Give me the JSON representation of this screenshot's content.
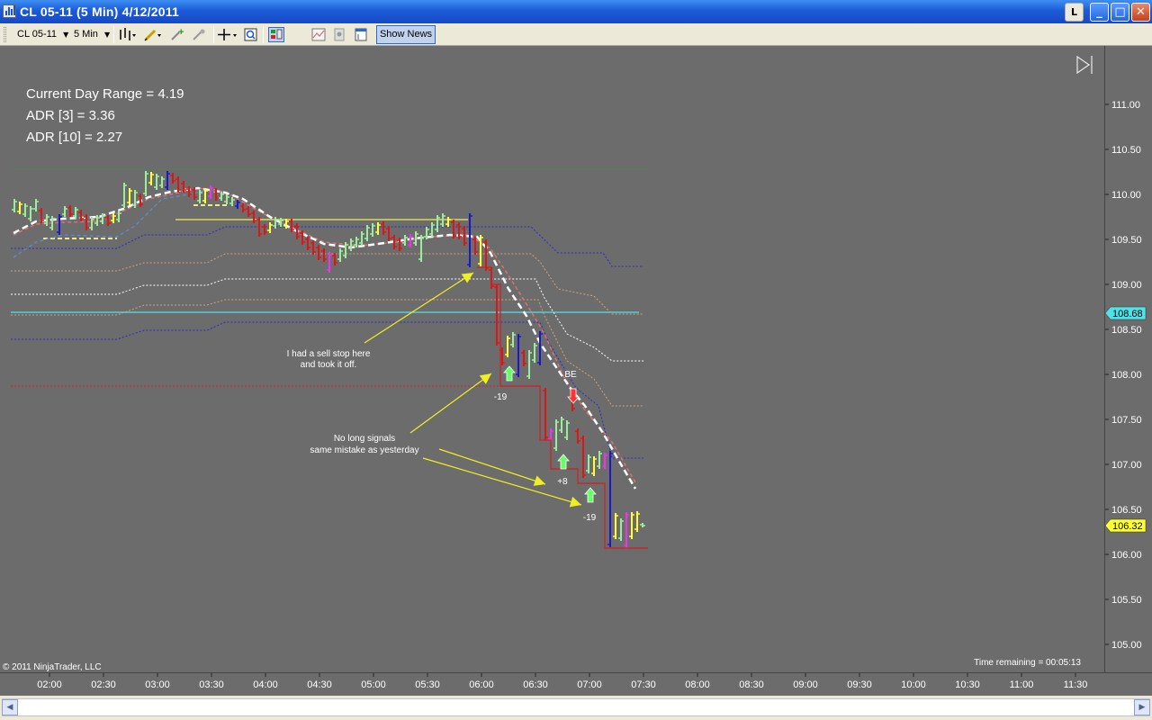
{
  "window": {
    "title": "CL 05-11 (5 Min)  4/12/2011",
    "buttons": {
      "light": "L",
      "minimize": "_",
      "maximize": "□",
      "close": "✕"
    }
  },
  "toolbar": {
    "instrument": "CL 05-11",
    "interval": "5 Min",
    "show_news": "Show News",
    "icons": [
      "bars-style-icon",
      "pencil-draw-icon",
      "add-indicator-icon",
      "strategy-icon",
      "crosshair-icon",
      "zoom-icon",
      "chart-trader-icon",
      "data-box-icon",
      "properties-icon",
      "print-icon",
      "template-icon"
    ]
  },
  "chart": {
    "stats": [
      "Current Day Range = 4.19",
      "ADR [3] = 3.36",
      "ADR [10] = 2.27"
    ],
    "y_labels": [
      "111.00",
      "110.50",
      "110.00",
      "109.50",
      "109.00",
      "108.50",
      "108.00",
      "107.50",
      "107.00",
      "106.50",
      "106.00",
      "105.50",
      "105.00"
    ],
    "x_labels": [
      "02:00",
      "02:30",
      "03:00",
      "03:30",
      "04:00",
      "04:30",
      "05:00",
      "05:30",
      "06:00",
      "06:30",
      "07:00",
      "07:30",
      "08:00",
      "08:30",
      "09:00",
      "09:30",
      "10:00",
      "10:30",
      "11:00",
      "11:30"
    ],
    "price_tag_cyan": "108.68",
    "price_tag_yellow": "106.32",
    "copyright": "© 2011 NinjaTrader, LLC",
    "time_remaining": "Time remaining = 00:05:13",
    "annotations": {
      "sell_stop_1": "I had a sell stop here",
      "sell_stop_2": "and took it off.",
      "no_long_1": "No long signals",
      "no_long_2": "same mistake as yesterday",
      "be": "BE",
      "minus19a": "-19",
      "plus8": "+8",
      "minus19b": "-19"
    },
    "colors": {
      "background": "#6c6c6c",
      "up_bar": "#99ee99",
      "down_bar": "#e01414",
      "neutral_bar": "#ffff33",
      "magenta_bar": "#ee33ee",
      "blue_bar": "#1a1acc"
    }
  }
}
